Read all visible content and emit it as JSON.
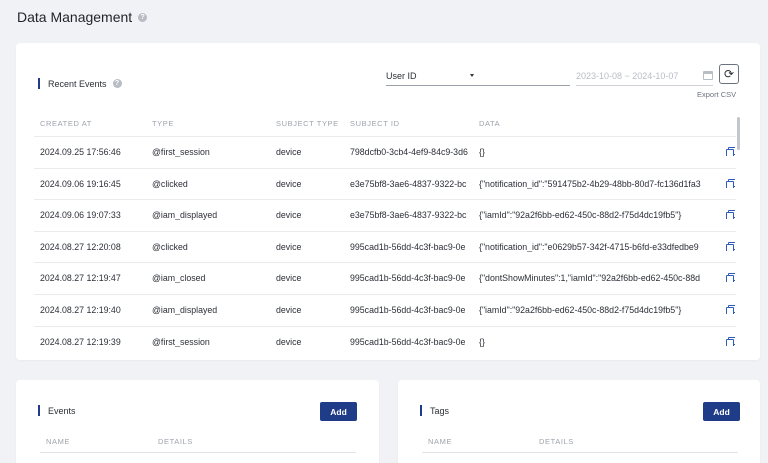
{
  "page": {
    "title": "Data Management"
  },
  "recent_events": {
    "title": "Recent Events",
    "filter": {
      "selected": "User ID",
      "id_value": "",
      "date_range": "2023-10-08 ~ 2024-10-07"
    },
    "export_label": "Export CSV",
    "columns": [
      "CREATED AT",
      "TYPE",
      "SUBJECT TYPE",
      "SUBJECT ID",
      "DATA"
    ],
    "rows": [
      [
        "2024.09.25 17:56:46",
        "@first_session",
        "device",
        "798dcfb0-3cb4-4ef9-84c9-3d6",
        "{}"
      ],
      [
        "2024.09.06 19:16:45",
        "@clicked",
        "device",
        "e3e75bf8-3ae6-4837-9322-bc",
        "{\"notification_id\":\"591475b2-4b29-48bb-80d7-fc136d1fa3"
      ],
      [
        "2024.09.06 19:07:33",
        "@iam_displayed",
        "device",
        "e3e75bf8-3ae6-4837-9322-bc",
        "{\"iamId\":\"92a2f6bb-ed62-450c-88d2-f75d4dc19fb5\"}"
      ],
      [
        "2024.08.27 12:20:08",
        "@clicked",
        "device",
        "995cad1b-56dd-4c3f-bac9-0e",
        "{\"notification_id\":\"e0629b57-342f-4715-b6fd-e33dfedbe9"
      ],
      [
        "2024.08.27 12:19:47",
        "@iam_closed",
        "device",
        "995cad1b-56dd-4c3f-bac9-0e",
        "{\"dontShowMinutes\":1,\"iamId\":\"92a2f6bb-ed62-450c-88d"
      ],
      [
        "2024.08.27 12:19:40",
        "@iam_displayed",
        "device",
        "995cad1b-56dd-4c3f-bac9-0e",
        "{\"iamId\":\"92a2f6bb-ed62-450c-88d2-f75d4dc19fb5\"}"
      ],
      [
        "2024.08.27 12:19:39",
        "@first_session",
        "device",
        "995cad1b-56dd-4c3f-bac9-0e",
        "{}"
      ]
    ]
  },
  "events_panel": {
    "title": "Events",
    "add_label": "Add",
    "columns": [
      "NAME",
      "DETAILS"
    ]
  },
  "tags_panel": {
    "title": "Tags",
    "add_label": "Add",
    "columns": [
      "NAME",
      "DETAILS"
    ]
  }
}
